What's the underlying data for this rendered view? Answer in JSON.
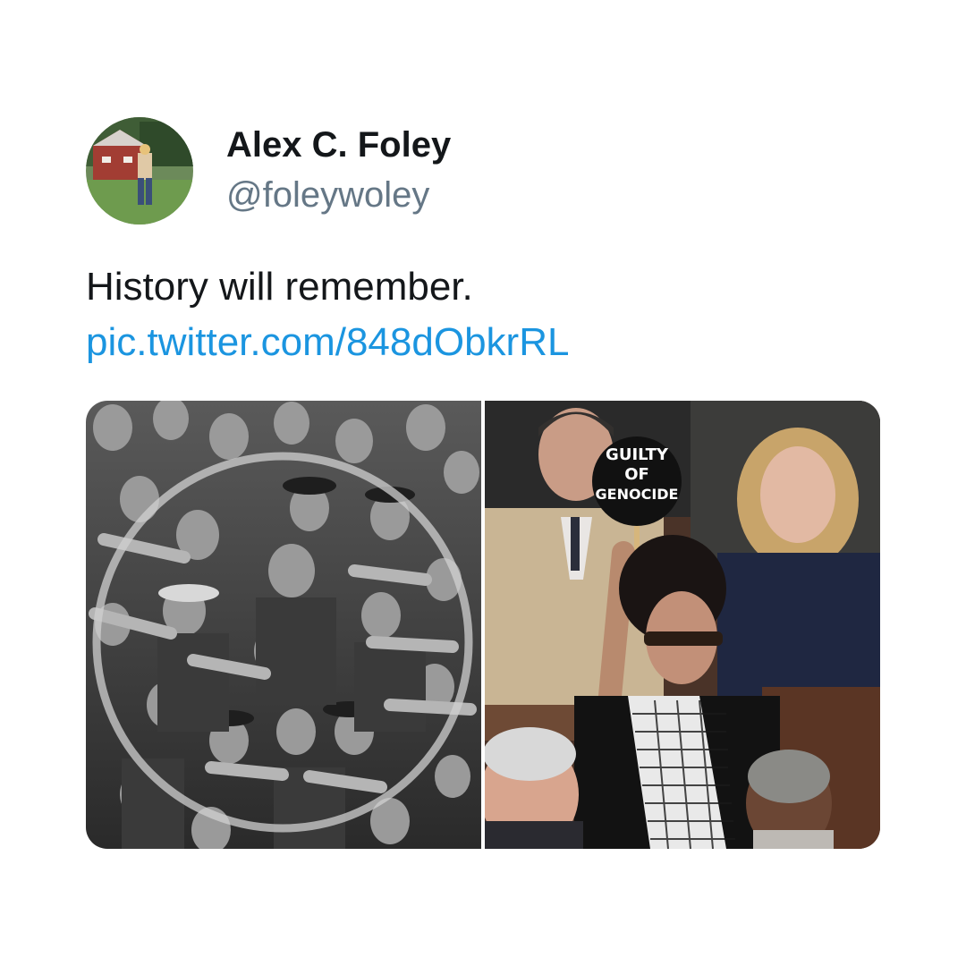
{
  "user": {
    "display_name": "Alex C. Foley",
    "handle": "@foleywoley"
  },
  "tweet": {
    "text": "History will remember.",
    "link": "pic.twitter.com/848dObkrRL"
  },
  "media": {
    "right_photo": {
      "sign_text": [
        "GUILTY",
        "OF",
        "GENOCIDE"
      ]
    }
  },
  "colors": {
    "text": "#14171a",
    "secondary": "#657786",
    "link": "#1b95e0"
  }
}
